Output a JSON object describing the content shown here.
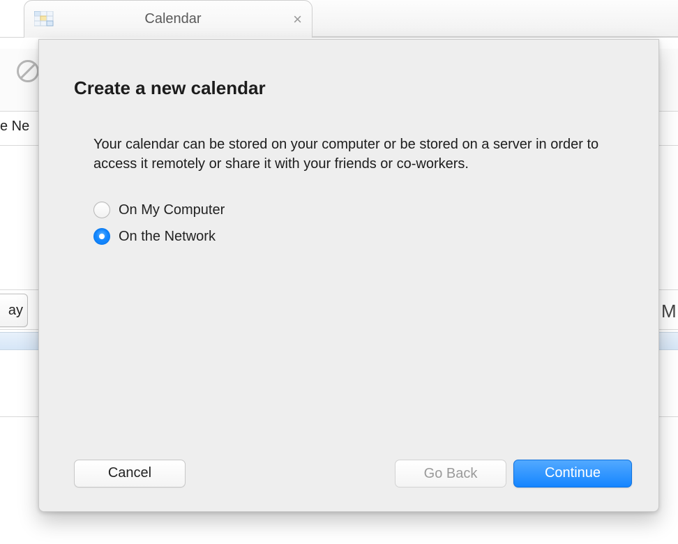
{
  "tab": {
    "icon": "calendar-grid-icon",
    "title": "Calendar",
    "close_glyph": "×"
  },
  "background": {
    "blocked_icon": "blocked-circle-icon",
    "peek_text": "e Ne",
    "today_button_label": "ay",
    "right_edge_letter": "M"
  },
  "dialog": {
    "title": "Create a new calendar",
    "description": "Your calendar can be stored on your computer or be stored on a server in order to access it remotely or share it with your friends or co-workers.",
    "options": [
      {
        "label": "On My Computer",
        "selected": false
      },
      {
        "label": "On the Network",
        "selected": true
      }
    ],
    "buttons": {
      "cancel": "Cancel",
      "go_back": "Go Back",
      "continue": "Continue"
    }
  }
}
